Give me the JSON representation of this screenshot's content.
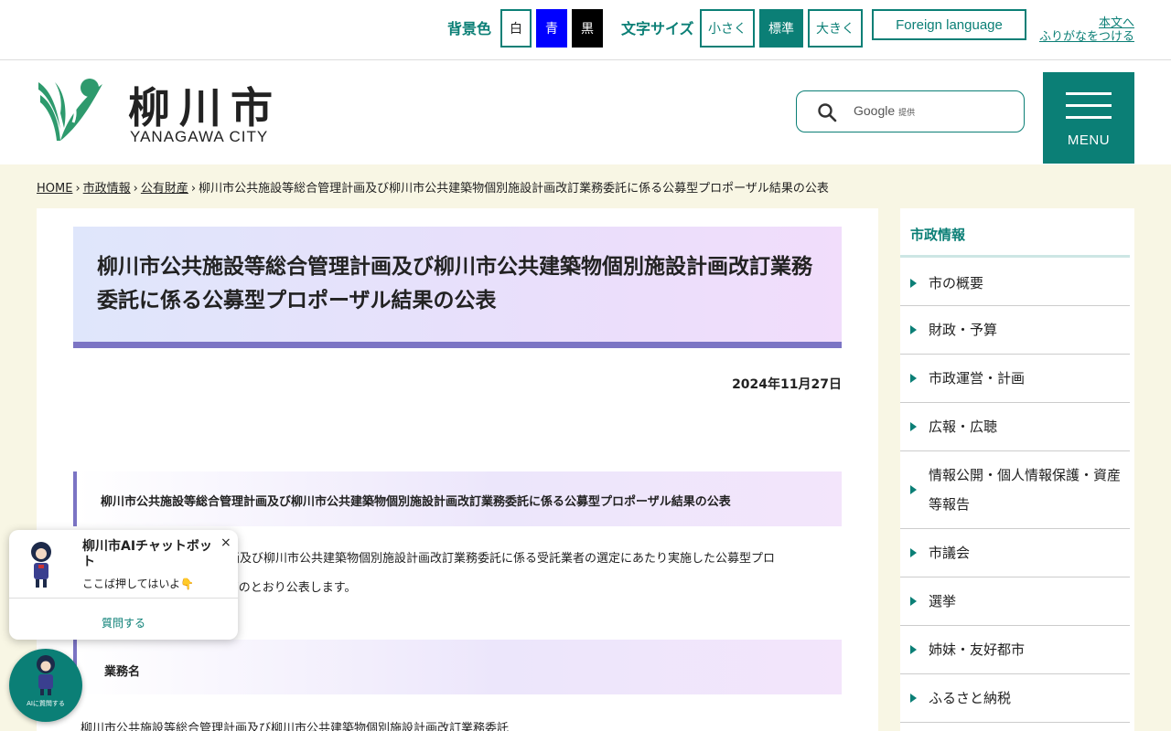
{
  "utility": {
    "bg_label": "背景色",
    "bg_white": "白",
    "bg_blue": "青",
    "bg_black": "黒",
    "size_label": "文字サイズ",
    "size_small": "小さく",
    "size_normal": "標準",
    "size_large": "大きく",
    "foreign": "Foreign language",
    "skip_main": "本文へ",
    "furigana": "ふりがなをつける"
  },
  "header": {
    "logo_jp": "柳川市",
    "logo_en": "YANAGAWA CITY",
    "search_provider": "Google",
    "search_provider_suffix": "提供",
    "menu_label": "MENU"
  },
  "breadcrumb": {
    "home": "HOME",
    "level1": "市政情報",
    "level2": "公有財産",
    "current": "柳川市公共施設等総合管理計画及び柳川市公共建築物個別施設計画改訂業務委託に係る公募型プロポーザル結果の公表"
  },
  "main": {
    "title": "柳川市公共施設等総合管理計画及び柳川市公共建築物個別施設計画改訂業務委託に係る公募型プロポーザル結果の公表",
    "date": "2024年11月27日",
    "section1_heading": "柳川市公共施設等総合管理計画及び柳川市公共建築物個別施設計画改訂業務委託に係る公募型プロポーザル結果の公表",
    "section1_line1": "柳川市公共施設等総合管理計画及び柳川市公共建築物個別施設計画改訂業務委託に係る受託業者の選定にあたり実施した公募型プロ",
    "section1_line2": "ポーザルの結果について、以下のとおり公表します。",
    "section2_heading": "業務名",
    "section2_body": "柳川市公共施設等総合管理計画及び柳川市公共建築物個別施設計画改訂業務委託"
  },
  "sidebar": {
    "title": "市政情報",
    "items": [
      {
        "label": "市の概要"
      },
      {
        "label": "財政・予算"
      },
      {
        "label": "市政運営・計画"
      },
      {
        "label": "広報・広聴"
      },
      {
        "label": "情報公開・個人情報保護・資産等報告"
      },
      {
        "label": "市議会"
      },
      {
        "label": "選挙"
      },
      {
        "label": "姉妹・友好都市"
      },
      {
        "label": "ふるさと納税"
      }
    ]
  },
  "chatbot": {
    "title": "柳川市AIチャットボット",
    "subtitle": "ここば押してはいよ👇",
    "close": "×",
    "ask": "質問する",
    "fab_label": "AIに質問する"
  },
  "colors": {
    "accent": "#0b7f76",
    "title_border": "#7b74c4",
    "page_bg": "#f8f6e4"
  }
}
